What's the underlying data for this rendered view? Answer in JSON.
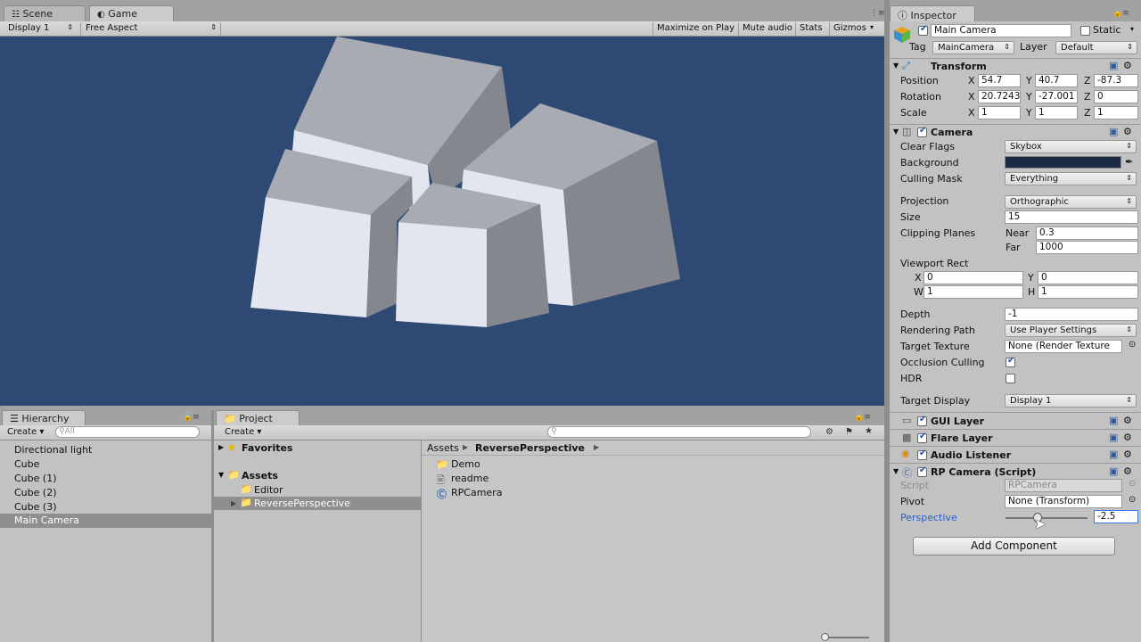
{
  "tabs": {
    "scene": "Scene",
    "game": "Game",
    "inspector": "Inspector",
    "hierarchy": "Hierarchy",
    "project": "Project"
  },
  "game_toolbar": {
    "display": "Display 1",
    "aspect": "Free Aspect",
    "maximize": "Maximize on Play",
    "mute": "Mute audio",
    "stats": "Stats",
    "gizmos": "Gizmos"
  },
  "colors": {
    "game_bg": "#2e4a74",
    "cube_light": "#e4e6ef",
    "cube_top": "#a8aab4",
    "cube_side": "#85878f"
  },
  "hierarchy": {
    "create": "Create",
    "search_placeholder": "All",
    "items": [
      "Directional light",
      "Cube",
      "Cube (1)",
      "Cube (2)",
      "Cube (3)",
      "Main Camera"
    ]
  },
  "project": {
    "create": "Create",
    "favorites": "Favorites",
    "assets": "Assets",
    "folders": [
      "Editor",
      "ReversePerspective"
    ],
    "breadcrumb": {
      "root": "Assets",
      "current": "ReversePerspective"
    },
    "files": [
      "Demo",
      "readme",
      "RPCamera"
    ]
  },
  "inspector": {
    "object_name": "Main Camera",
    "static_label": "Static",
    "tag_label": "Tag",
    "tag_value": "MainCamera",
    "layer_label": "Layer",
    "layer_value": "Default",
    "transform": {
      "title": "Transform",
      "position_label": "Position",
      "position": {
        "x": "54.7",
        "y": "40.7",
        "z": "-87.3"
      },
      "rotation_label": "Rotation",
      "rotation": {
        "x": "20.7243",
        "y": "-27.001",
        "z": "0"
      },
      "scale_label": "Scale",
      "scale": {
        "x": "1",
        "y": "1",
        "z": "1"
      },
      "x": "X",
      "y": "Y",
      "z": "Z"
    },
    "camera": {
      "title": "Camera",
      "clear_flags_label": "Clear Flags",
      "clear_flags": "Skybox",
      "background_label": "Background",
      "background_color": "#1c2a44",
      "culling_mask_label": "Culling Mask",
      "culling_mask": "Everything",
      "projection_label": "Projection",
      "projection": "Orthographic",
      "size_label": "Size",
      "size": "15",
      "clipping_label": "Clipping Planes",
      "near_label": "Near",
      "near": "0.3",
      "far_label": "Far",
      "far": "1000",
      "viewport_label": "Viewport Rect",
      "vx": "0",
      "vy": "0",
      "vw": "1",
      "vh": "1",
      "w": "W",
      "h": "H",
      "depth_label": "Depth",
      "depth": "-1",
      "rendering_path_label": "Rendering Path",
      "rendering_path": "Use Player Settings",
      "target_texture_label": "Target Texture",
      "target_texture": "None (Render Texture",
      "occlusion_label": "Occlusion Culling",
      "hdr_label": "HDR",
      "target_display_label": "Target Display",
      "target_display": "Display 1"
    },
    "gui_layer": "GUI Layer",
    "flare_layer": "Flare Layer",
    "audio_listener": "Audio Listener",
    "rp_camera": {
      "title": "RP Camera (Script)",
      "script_label": "Script",
      "script": "RPCamera",
      "pivot_label": "Pivot",
      "pivot": "None (Transform)",
      "perspective_label": "Perspective",
      "perspective": "-2.5"
    },
    "add_component": "Add Component"
  }
}
